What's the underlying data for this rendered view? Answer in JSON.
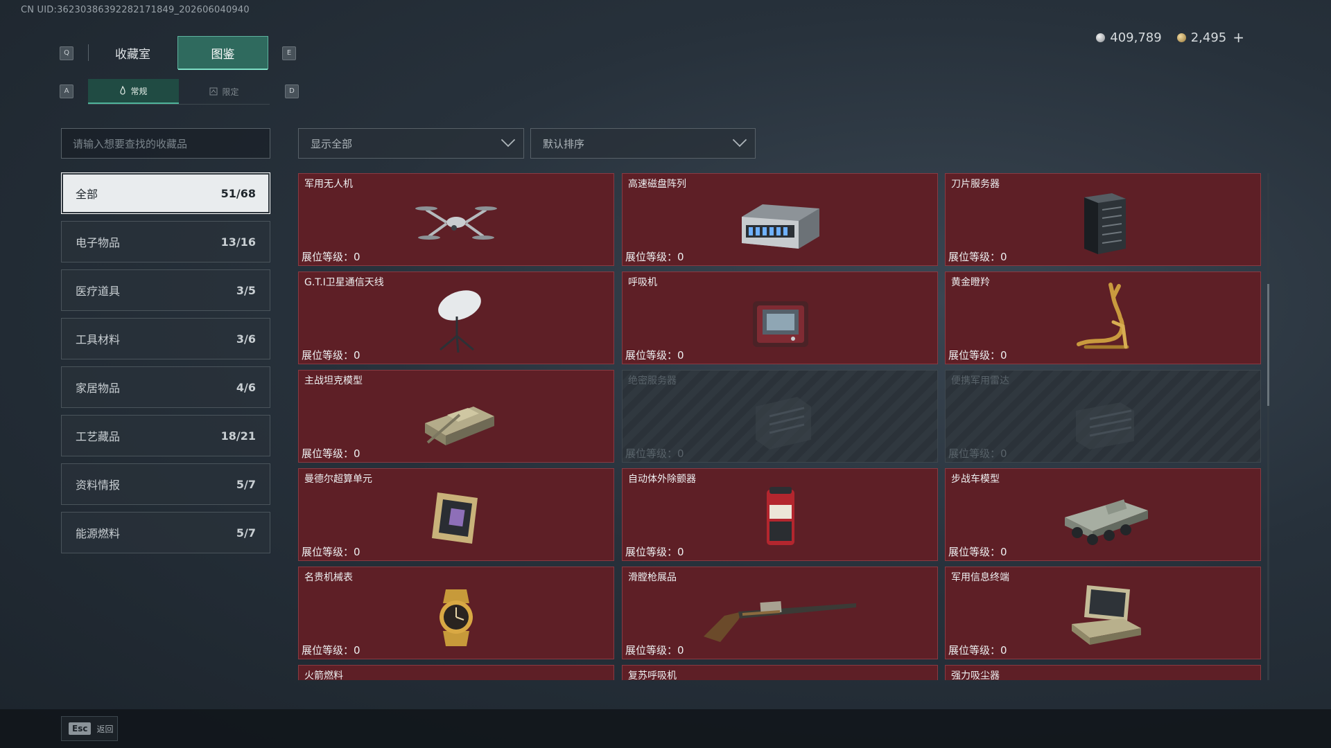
{
  "uid": "CN UID:36230386392282171849_202606040940",
  "currency": {
    "silver": "409,789",
    "gold": "2,495",
    "plus": "+"
  },
  "keys": {
    "q": "Q",
    "e": "E",
    "a": "A",
    "d": "D"
  },
  "tabs": [
    {
      "label": "收藏室"
    },
    {
      "label": "图鉴"
    }
  ],
  "subtabs": [
    {
      "label": "常规"
    },
    {
      "label": "限定"
    }
  ],
  "search": {
    "placeholder": "请输入想要查找的收藏品"
  },
  "filter": {
    "label": "显示全部"
  },
  "sort": {
    "label": "默认排序"
  },
  "categories": [
    {
      "label": "全部",
      "count": "51/68"
    },
    {
      "label": "电子物品",
      "count": "13/16"
    },
    {
      "label": "医疗道具",
      "count": "3/5"
    },
    {
      "label": "工具材料",
      "count": "3/6"
    },
    {
      "label": "家居物品",
      "count": "4/6"
    },
    {
      "label": "工艺藏品",
      "count": "18/21"
    },
    {
      "label": "资料情报",
      "count": "5/7"
    },
    {
      "label": "能源燃料",
      "count": "5/7"
    }
  ],
  "items": [
    {
      "name": "军用无人机",
      "level": "展位等级：0",
      "icon": "drone-icon"
    },
    {
      "name": "高速磁盘阵列",
      "level": "展位等级：0",
      "icon": "disk-array-icon"
    },
    {
      "name": "刀片服务器",
      "level": "展位等级：0",
      "icon": "blade-server-icon"
    },
    {
      "name": "G.T.I卫星通信天线",
      "level": "展位等级：0",
      "icon": "satellite-dish-icon"
    },
    {
      "name": "呼吸机",
      "level": "展位等级：0",
      "icon": "ventilator-icon"
    },
    {
      "name": "黄金瞪羚",
      "level": "展位等级：0",
      "icon": "golden-gazelle-icon"
    },
    {
      "name": "主战坦克模型",
      "level": "展位等级：0",
      "icon": "tank-icon"
    },
    {
      "name": "绝密服务器",
      "level": "展位等级：0",
      "icon": "server-icon"
    },
    {
      "name": "便携军用雷达",
      "level": "展位等级：0",
      "icon": "radar-icon"
    },
    {
      "name": "曼德尔超算单元",
      "level": "展位等级：0",
      "icon": "compute-unit-icon"
    },
    {
      "name": "自动体外除颤器",
      "level": "展位等级：0",
      "icon": "defibrillator-icon"
    },
    {
      "name": "步战车模型",
      "level": "展位等级：0",
      "icon": "ifv-icon"
    },
    {
      "name": "名贵机械表",
      "level": "展位等级：0",
      "icon": "watch-icon"
    },
    {
      "name": "滑膛枪展品",
      "level": "展位等级：0",
      "icon": "musket-icon"
    },
    {
      "name": "军用信息终端",
      "level": "展位等级：0",
      "icon": "terminal-icon"
    },
    {
      "name": "火箭燃料",
      "level": "",
      "icon": "rocket-fuel-icon"
    },
    {
      "name": "复苏呼吸机",
      "level": "",
      "icon": "resuscitator-icon"
    },
    {
      "name": "强力吸尘器",
      "level": "",
      "icon": "vacuum-icon"
    }
  ],
  "footer": {
    "key": "Esc",
    "label": "返回"
  }
}
